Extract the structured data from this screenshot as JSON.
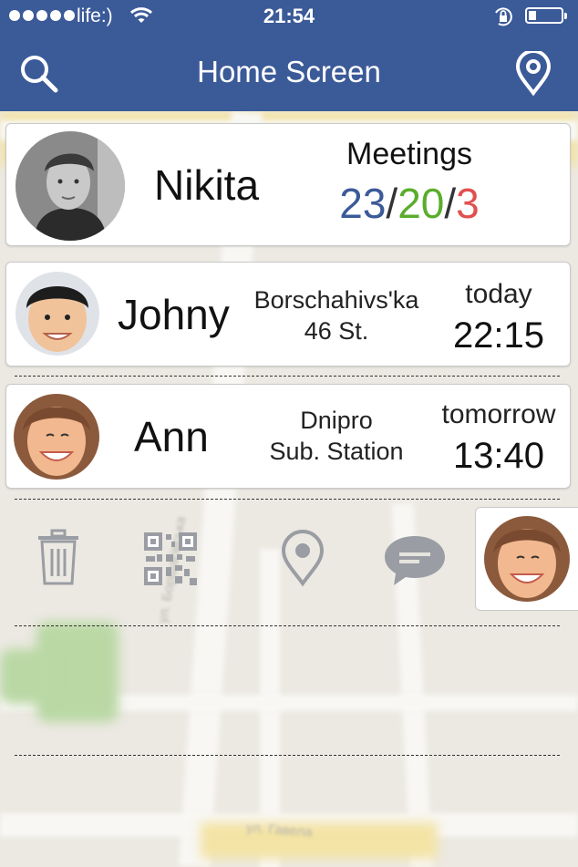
{
  "status_bar": {
    "carrier": "life:)",
    "time": "21:54",
    "icons": [
      "signal-dots-icon",
      "wifi-icon",
      "orientation-lock-icon",
      "battery-icon"
    ]
  },
  "nav": {
    "title": "Home Screen",
    "left_icon": "search-icon",
    "right_icon": "location-pin-icon",
    "bar_color": "#3b5a98"
  },
  "profile": {
    "name": "Nikita",
    "meetings_label": "Meetings",
    "total": "23",
    "done": "20",
    "missed": "3",
    "sep": "/",
    "colors": {
      "total": "#3b5a98",
      "done": "#5aad2c",
      "missed": "#e0504f"
    }
  },
  "meetings": [
    {
      "name": "Johny",
      "place_line1": "Borschahivs'ka",
      "place_line2": "46 St.",
      "day": "today",
      "time": "22:15"
    },
    {
      "name": "Ann",
      "place_line1": "Dnipro",
      "place_line2": "Sub. Station",
      "day": "tomorrow",
      "time": "13:40"
    }
  ],
  "actions": [
    "trash-icon",
    "qr-code-icon",
    "location-pin-icon",
    "chat-bubble-icon"
  ],
  "map_labels": [
    "ул. Борщагівська",
    "ул. Гавела"
  ]
}
